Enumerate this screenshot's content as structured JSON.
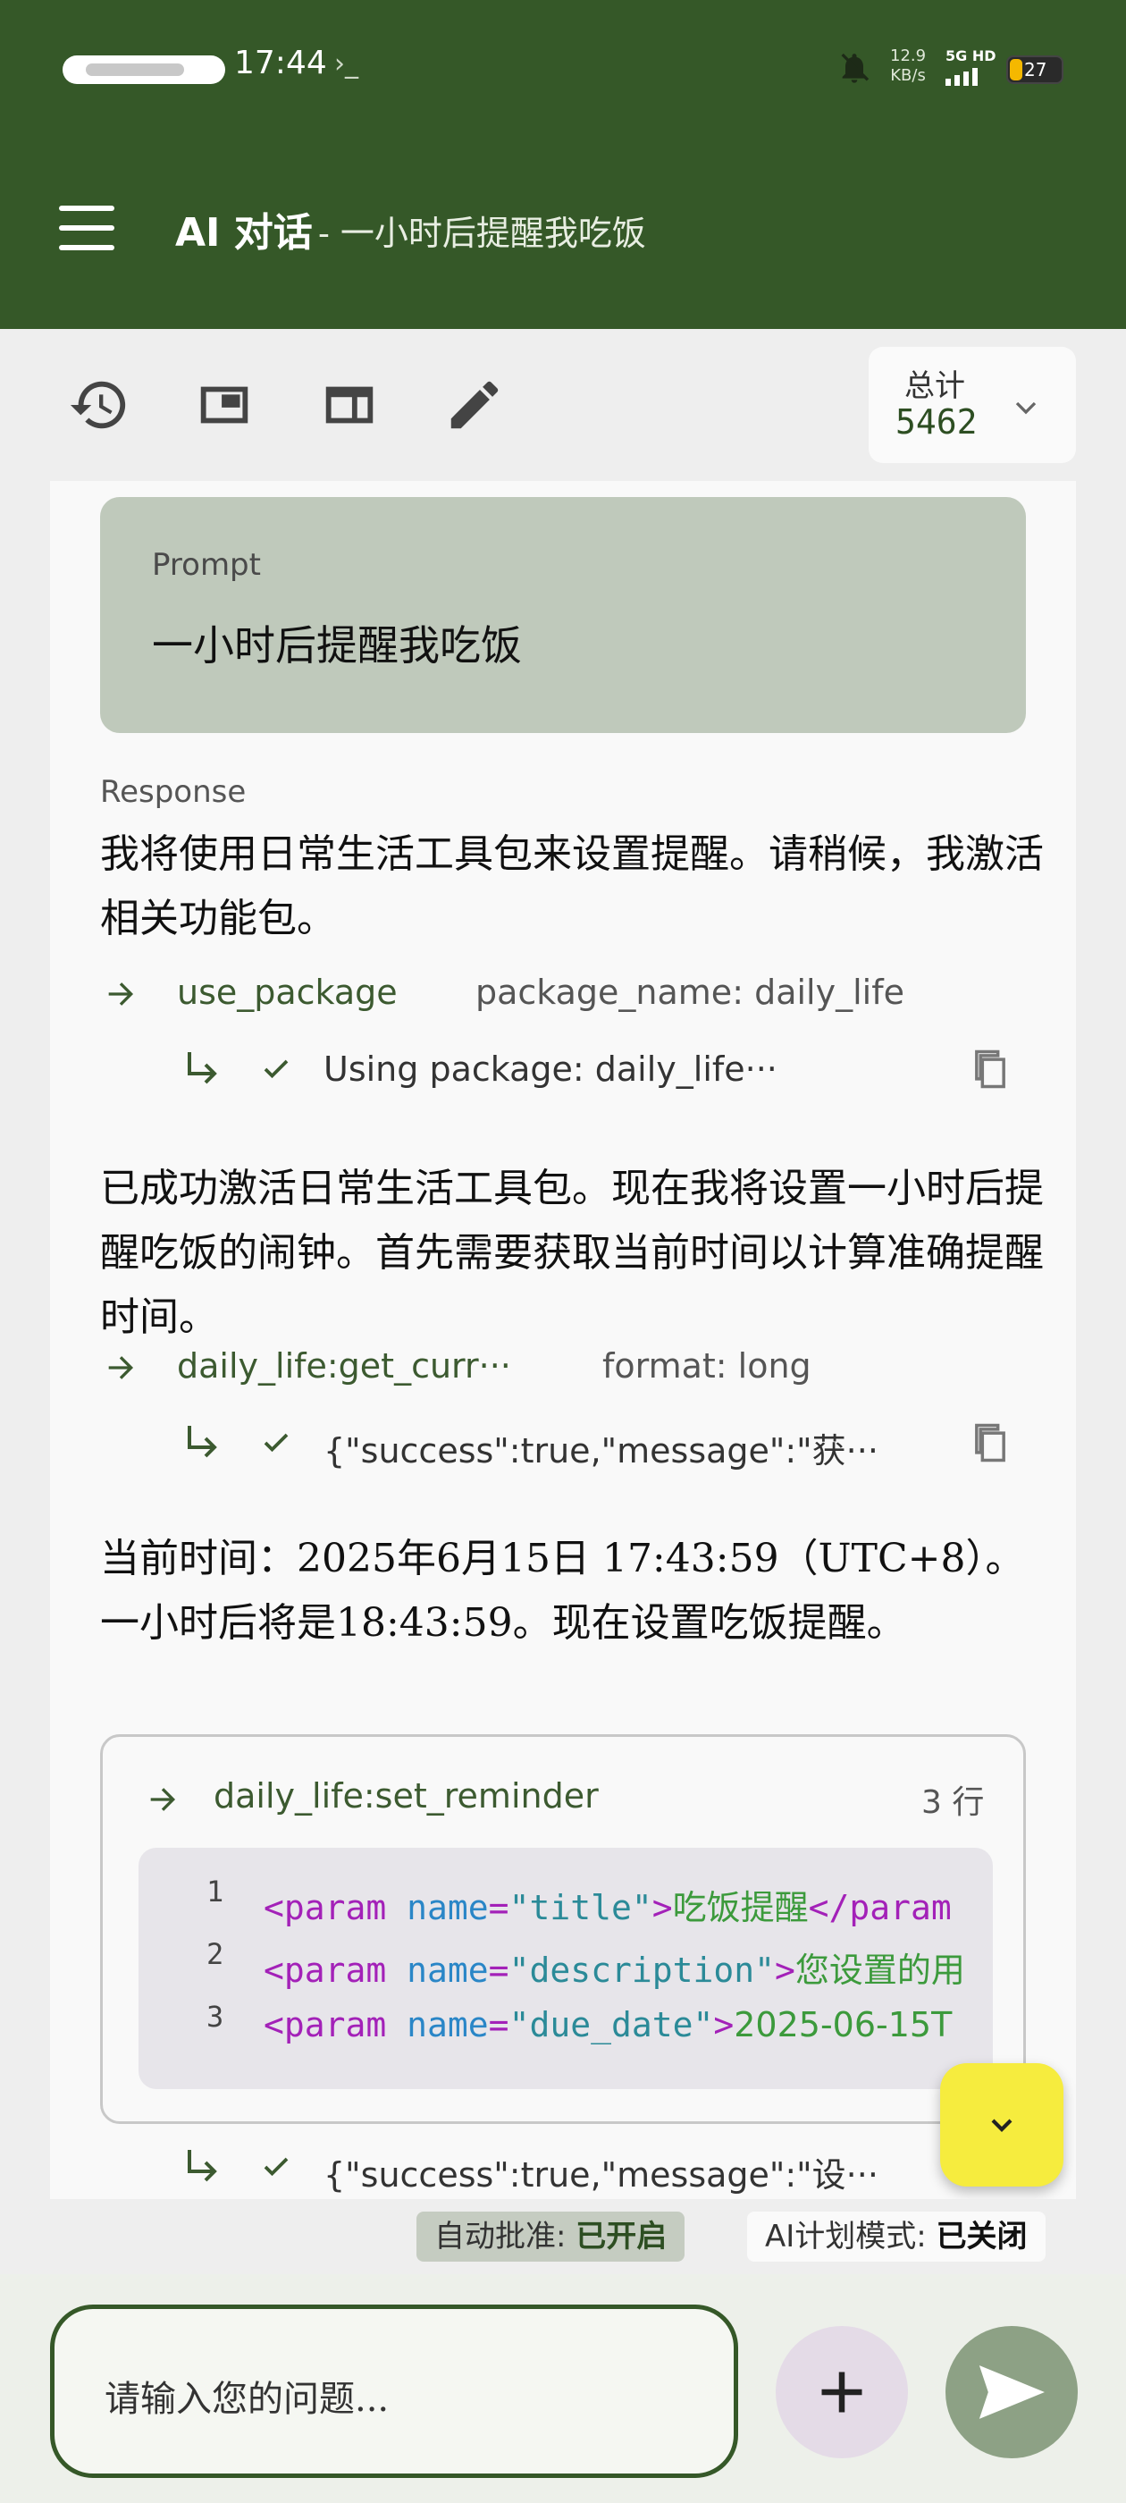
{
  "status_bar": {
    "time": "17:44",
    "net_speed_value": "12.9",
    "net_speed_unit": "KB/s",
    "signal_label": "5G HD",
    "battery": "27"
  },
  "header": {
    "title": "AI 对话",
    "subtitle": "- 一小时后提醒我吃饭"
  },
  "toolbar": {
    "total_label": "总计",
    "total_value": "5462"
  },
  "prompt": {
    "label": "Prompt",
    "text": "一小时后提醒我吃饭"
  },
  "response": {
    "label": "Response",
    "para1": "我将使用日常生活工具包来设置提醒。请稍候，我激活相关功能包。",
    "tool1": {
      "name": "use_package",
      "param": "package_name: daily_life"
    },
    "result1": "Using package: daily_life···",
    "para2": "已成功激活日常生活工具包。现在我将设置一小时后提醒吃饭的闹钟。首先需要获取当前时间以计算准确提醒时间。",
    "tool2": {
      "name": "daily_life:get_curr···",
      "param": "format: long"
    },
    "result2": "{\"success\":true,\"message\":\"获···",
    "para3": "当前时间：2025年6月15日 17:43:59（UTC+8）。一小时后将是18:43:59。现在设置吃饭提醒。",
    "tool3": {
      "name": "daily_life:set_reminder",
      "lines_label": "3 行",
      "code": [
        {
          "ln": "1",
          "open": "<param",
          "attr": " name",
          "eq": "=",
          "val": "\"title\"",
          "close": ">",
          "text": "吃饭提醒",
          "end": "</param"
        },
        {
          "ln": "2",
          "open": "<param",
          "attr": " name",
          "eq": "=",
          "val": "\"description\"",
          "close": ">",
          "text": "您设置的用",
          "end": ""
        },
        {
          "ln": "3",
          "open": "<param",
          "attr": " name",
          "eq": "=",
          "val": "\"due_date\"",
          "close": ">",
          "text": "2025-06-15T",
          "end": ""
        }
      ]
    },
    "result3": "{\"success\":true,\"message\":\"设···"
  },
  "chips": {
    "auto_approve_label": "自动批准: ",
    "auto_approve_value": "已开启",
    "plan_mode_label": "AI计划模式: ",
    "plan_mode_value": "已关闭"
  },
  "input": {
    "placeholder": "请输入您的问题..."
  },
  "colors": {
    "primary": "#355828",
    "prompt_card": "#bfc9bb",
    "fab": "#f6ec3e",
    "send": "#8da185"
  }
}
